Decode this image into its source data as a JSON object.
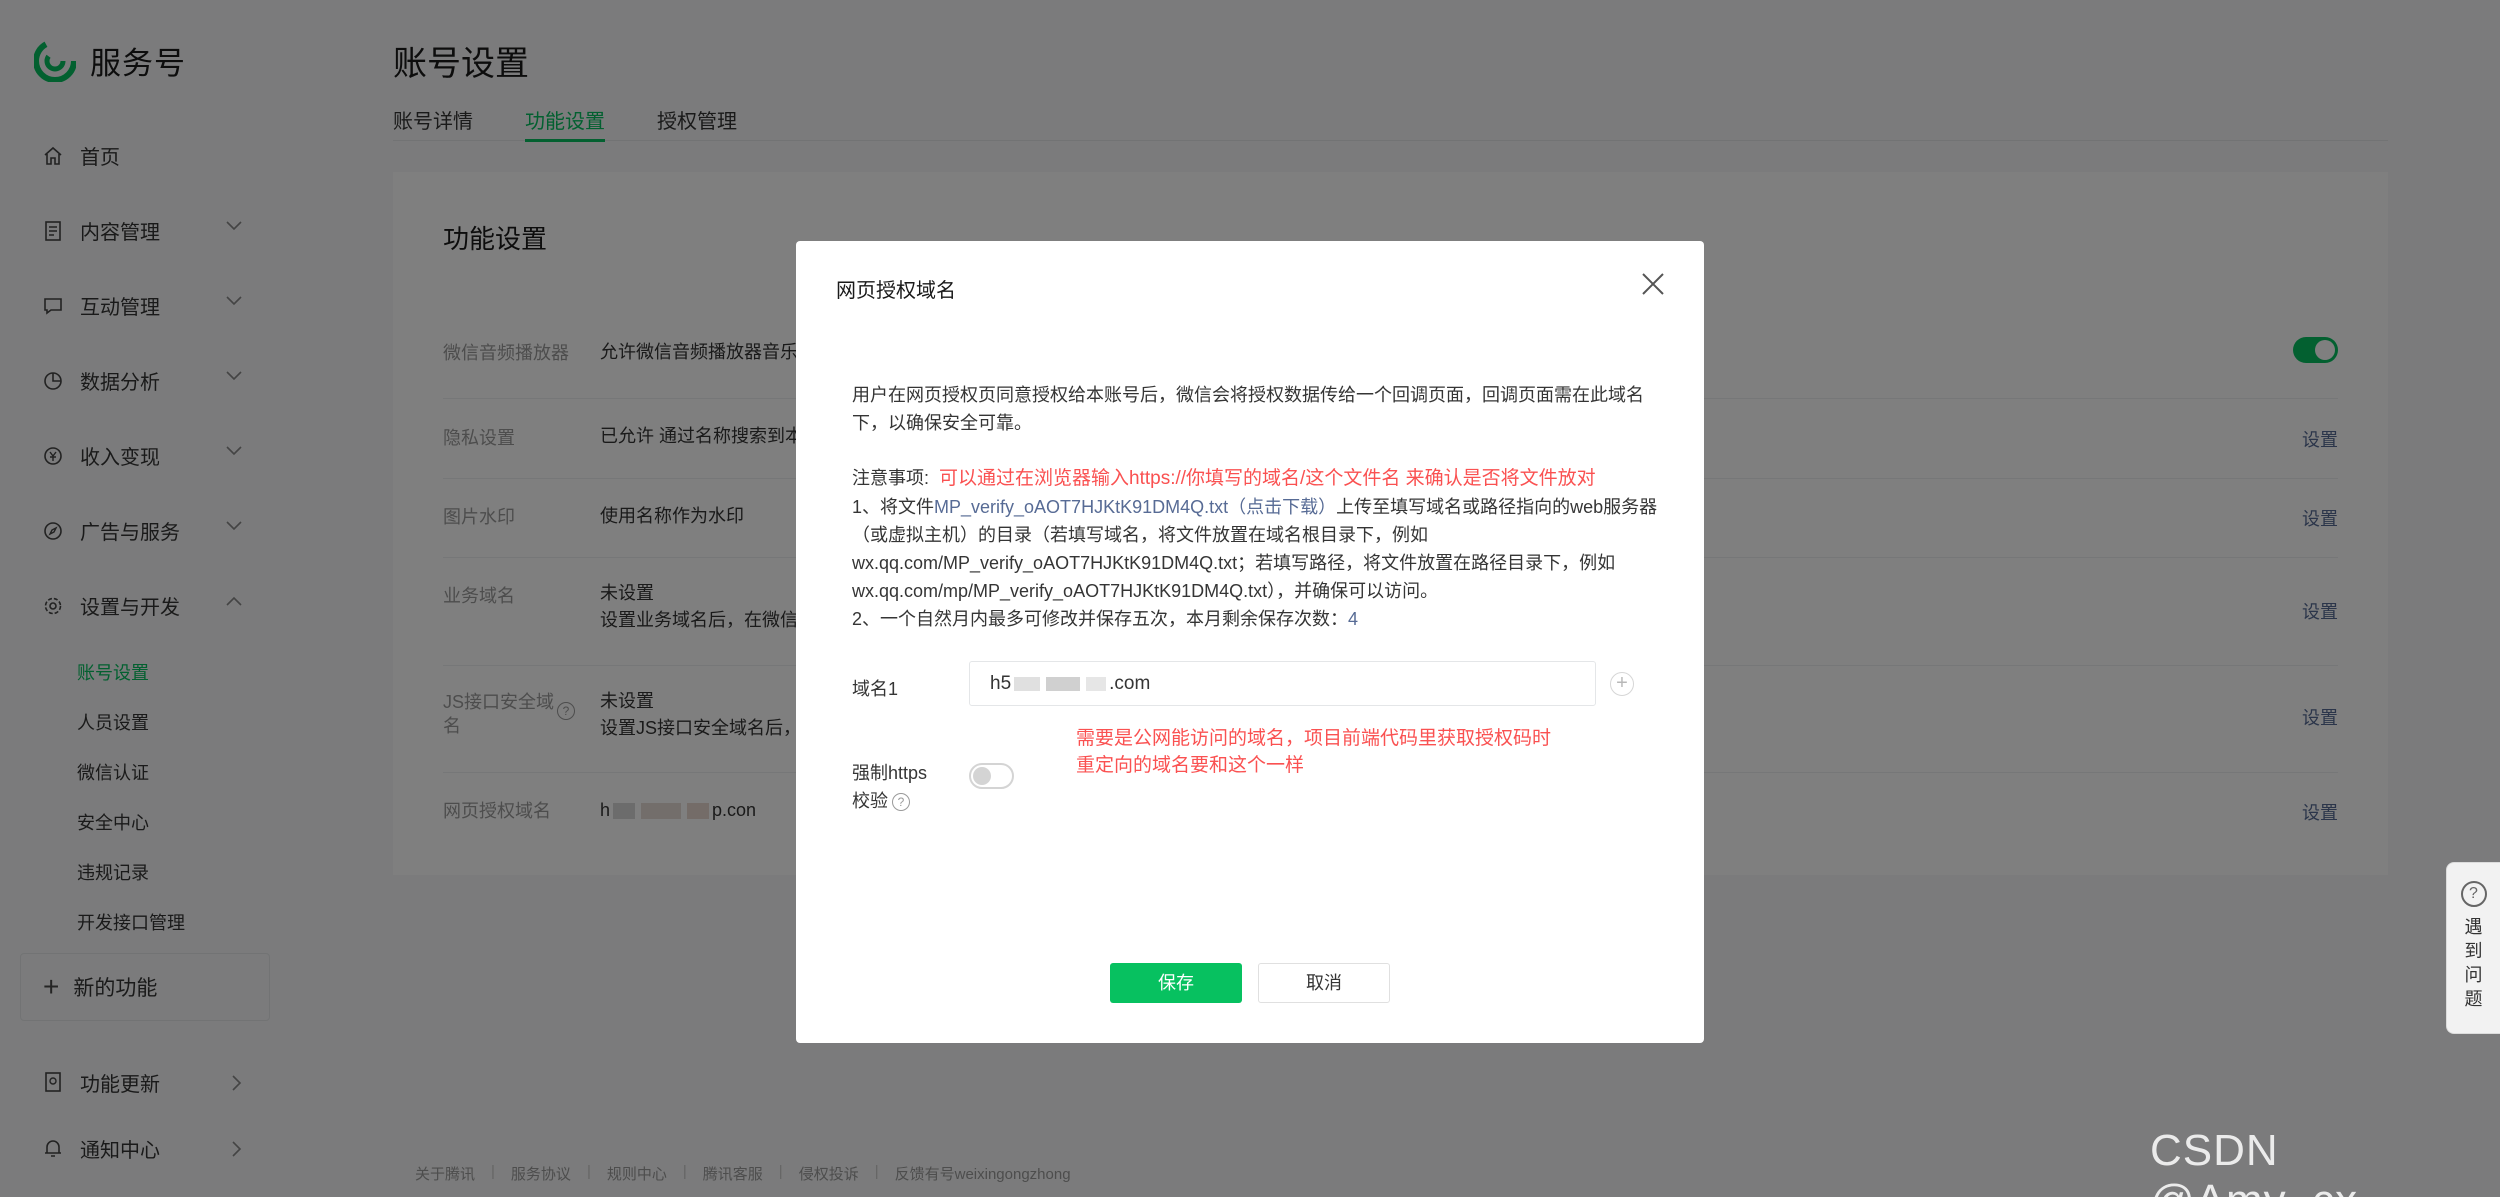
{
  "app": {
    "name": "服务号"
  },
  "sidebar": {
    "items": [
      {
        "label": "首页"
      },
      {
        "label": "内容管理"
      },
      {
        "label": "互动管理"
      },
      {
        "label": "数据分析"
      },
      {
        "label": "收入变现"
      },
      {
        "label": "广告与服务"
      },
      {
        "label": "设置与开发"
      }
    ],
    "sub_items": [
      {
        "label": "账号设置",
        "active": true
      },
      {
        "label": "人员设置"
      },
      {
        "label": "微信认证"
      },
      {
        "label": "安全中心"
      },
      {
        "label": "违规记录"
      },
      {
        "label": "开发接口管理"
      }
    ],
    "new_feature": "新的功能",
    "bottom": [
      {
        "label": "功能更新"
      },
      {
        "label": "通知中心"
      }
    ]
  },
  "page": {
    "title": "账号设置",
    "tabs": [
      {
        "label": "账号详情"
      },
      {
        "label": "功能设置",
        "active": true
      },
      {
        "label": "授权管理"
      }
    ]
  },
  "panel": {
    "title": "功能设置",
    "rows": [
      {
        "label": "微信音频播放器",
        "value": "允许微信音频播放器音乐播",
        "toggle": true
      },
      {
        "label": "隐私设置",
        "value": "已允许 通过名称搜索到本",
        "action": "设置"
      },
      {
        "label": "图片水印",
        "value": "使用名称作为水印",
        "action": "设置"
      },
      {
        "label": "业务域名",
        "value": "未设置",
        "value2": "设置业务域名后，在微信内",
        "action": "设置"
      },
      {
        "label": "JS接口安全域",
        "label2": "名",
        "value": "未设置",
        "value2": "设置JS接口安全域名后，",
        "action": "设置"
      },
      {
        "label": "网页授权域名",
        "value_prefix": "h",
        "value_suffix": "p.con",
        "action": "设置"
      }
    ]
  },
  "footer": {
    "links": [
      "关于腾讯",
      "服务协议",
      "规则中心",
      "腾讯客服",
      "侵权投诉",
      "反馈有号weixingongzhong"
    ]
  },
  "dialog": {
    "title": "网页授权域名",
    "desc": "用户在网页授权页同意授权给本账号后，微信会将授权数据传给一个回调页面，回调页面需在此域名下，以确保安全可靠。",
    "notes_label": "注意事项:",
    "annotation_top": "可以通过在浏览器输入https://你填写的域名/这个文件名 来确认是否将文件放对",
    "note1_prefix": "1、将文件",
    "file_link": "MP_verify_oAOT7HJKtK91DM4Q.txt（点击下载）",
    "note1_rest": "上传至填写域名或路径指向的web服务器（或虚拟主机）的目录（若填写域名，将文件放置在域名根目录下，例如wx.qq.com/MP_verify_oAOT7HJKtK91DM4Q.txt；若填写路径，将文件放置在路径目录下，例如wx.qq.com/mp/MP_verify_oAOT7HJKtK91DM4Q.txt），并确保可以访问。",
    "note2": "2、一个自然月内最多可修改并保存五次，本月剩余保存次数：",
    "remaining": "4",
    "domain_label": "域名1",
    "domain_value_prefix": "h5",
    "domain_value_suffix": ".com",
    "https_label": "强制https",
    "https_label2": "校验",
    "annotation_bottom_1": "需要是公网能访问的域名，项目前端代码里获取授权码时",
    "annotation_bottom_2": "重定向的域名要和这个一样",
    "save": "保存",
    "cancel": "取消"
  },
  "help": {
    "chars": [
      "遇",
      "到",
      "问",
      "题"
    ]
  },
  "watermark": "CSDN @Amy_cx",
  "colors": {
    "brand": "#07c160",
    "link": "#576b95",
    "warning": "#fa5151"
  }
}
